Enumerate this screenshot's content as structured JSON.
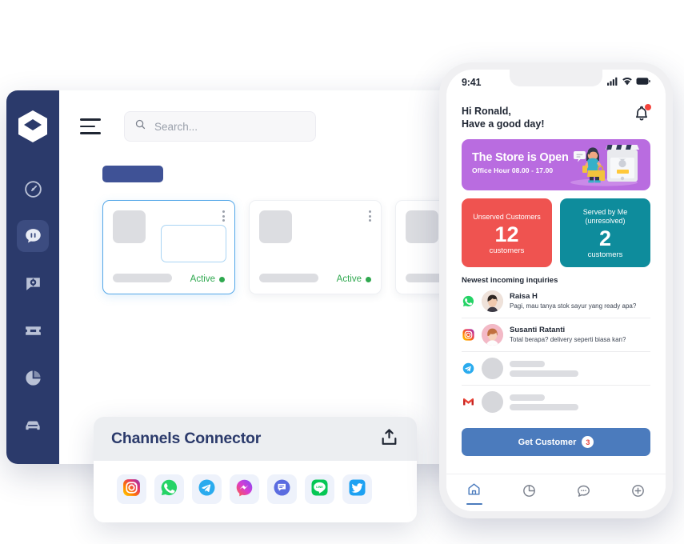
{
  "desktop": {
    "sidebar": {
      "logo_name": "app-logo-hexagon",
      "items": [
        {
          "name": "dashboard",
          "icon": "speedometer-icon",
          "active": false
        },
        {
          "name": "chat",
          "icon": "chat-bubble-icon",
          "active": true
        },
        {
          "name": "chat-settings",
          "icon": "chat-gear-icon",
          "active": false
        },
        {
          "name": "tickets",
          "icon": "ticket-icon",
          "active": false
        },
        {
          "name": "reports",
          "icon": "pie-chart-icon",
          "active": false
        },
        {
          "name": "fleet",
          "icon": "car-icon",
          "active": false
        }
      ]
    },
    "header": {
      "menu_icon": "hamburger-icon",
      "search_placeholder": "Search...",
      "search_value": "",
      "search_icon": "search-icon",
      "expand_icon": "fullscreen-icon"
    },
    "cards": [
      {
        "status": "Active",
        "selected": true
      },
      {
        "status": "Active",
        "selected": false
      },
      {
        "status": "",
        "selected": false
      }
    ]
  },
  "connector": {
    "title": "Channels Connector",
    "upload_icon": "upload-icon",
    "channels": [
      {
        "name": "instagram",
        "label": "Instagram"
      },
      {
        "name": "whatsapp",
        "label": "WhatsApp"
      },
      {
        "name": "telegram",
        "label": "Telegram"
      },
      {
        "name": "messenger",
        "label": "Messenger"
      },
      {
        "name": "sms",
        "label": "SMS"
      },
      {
        "name": "line",
        "label": "LINE"
      },
      {
        "name": "twitter",
        "label": "Twitter"
      }
    ]
  },
  "phone": {
    "statusbar": {
      "time": "9:41",
      "signal_icon": "signal-bars-icon",
      "wifi_icon": "wifi-icon",
      "battery_icon": "battery-icon"
    },
    "greeting": {
      "line1": "Hi Ronald,",
      "line2": "Have a good day!",
      "bell_icon": "notification-bell-icon",
      "has_notification": true
    },
    "banner": {
      "title": "The Store is Open",
      "subtitle": "Office Hour  08.00 - 17.00",
      "color": "#b96ce0",
      "illustration": "storefront-shopper-illustration"
    },
    "stats": [
      {
        "label": "Unserved Customers",
        "value": "12",
        "unit": "customers",
        "color": "#ef5350"
      },
      {
        "label": "Served by Me\n(unresolved)",
        "label_line1": "Served by Me",
        "label_line2": "(unresolved)",
        "value": "2",
        "unit": "customers",
        "color": "#0e8c9c"
      }
    ],
    "inquiries": {
      "title": "Newest incoming inquiries",
      "items": [
        {
          "channel": "whatsapp",
          "name": "Raisa H",
          "message": "Pagi, mau tanya stok sayur yang ready apa?",
          "skeleton": false
        },
        {
          "channel": "instagram",
          "name": "Susanti Ratanti",
          "message": "Total berapa? delivery seperti biasa kan?",
          "skeleton": false
        },
        {
          "channel": "telegram",
          "name": "",
          "message": "",
          "skeleton": true
        },
        {
          "channel": "gmail",
          "name": "",
          "message": "",
          "skeleton": true
        }
      ]
    },
    "get_customer": {
      "label": "Get Customer",
      "badge": "3"
    },
    "tabbar": [
      {
        "name": "home",
        "icon": "home-icon",
        "active": true
      },
      {
        "name": "stats",
        "icon": "pie-chart-icon",
        "active": false
      },
      {
        "name": "messages",
        "icon": "chat-dots-icon",
        "active": false
      },
      {
        "name": "add",
        "icon": "plus-circle-icon",
        "active": false
      }
    ]
  }
}
